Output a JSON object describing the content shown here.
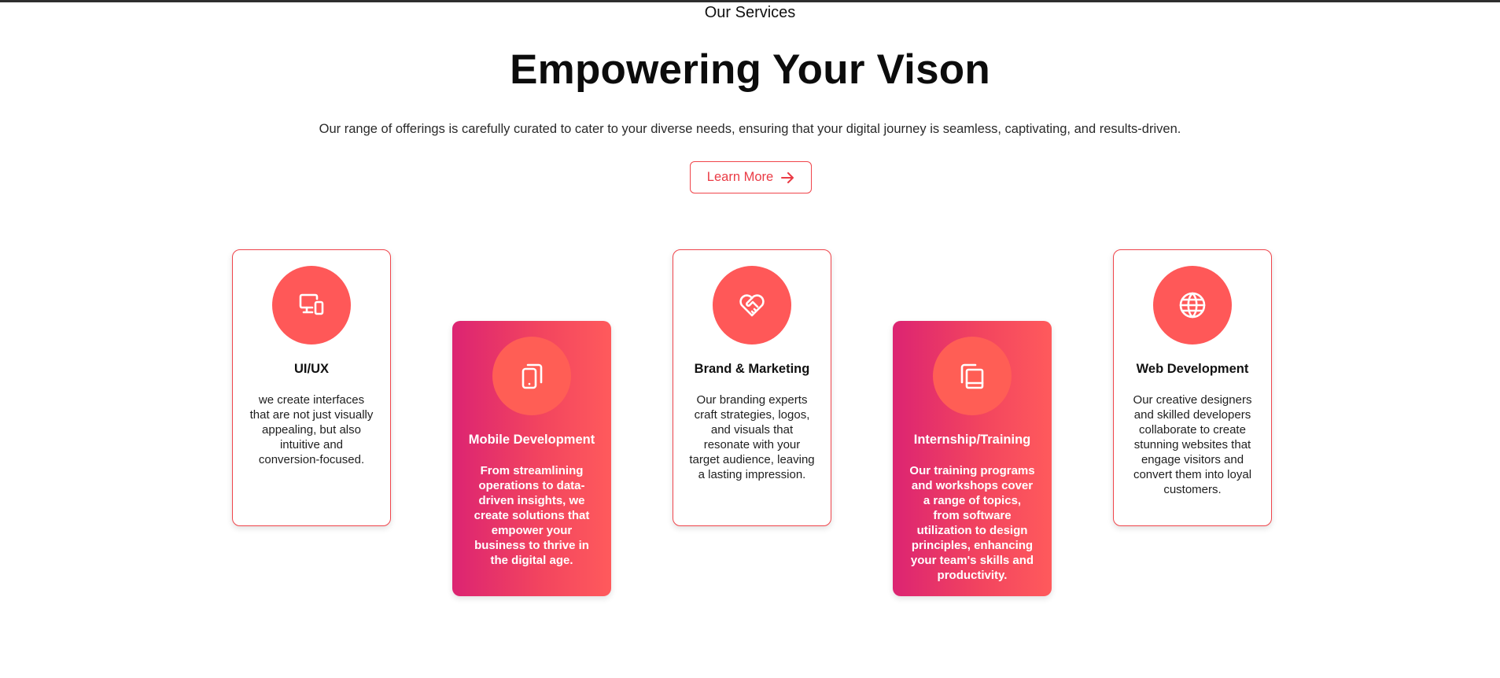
{
  "section": {
    "eyebrow": "Our Services",
    "headline": "Empowering Your Vison",
    "lead": "Our range of offerings is carefully curated to cater to your diverse needs, ensuring that your digital journey is seamless, captivating, and results-driven.",
    "cta_label": "Learn More"
  },
  "colors": {
    "accent": "#f0454b",
    "icon_bg": "#ff5858",
    "gradient_start": "#dc2472",
    "gradient_end": "#ff5a5c"
  },
  "cards": [
    {
      "icon": "devices-icon",
      "title": "UI/UX",
      "body": "we create interfaces that are not just visually appealing, but also intuitive and conversion-focused.",
      "style": "plain"
    },
    {
      "icon": "mobile-icon",
      "title": "Mobile Development",
      "body": "From streamlining operations to data-driven insights, we create solutions that empower your business to thrive in the digital age.",
      "style": "accent"
    },
    {
      "icon": "heart-handshake-icon",
      "title": "Brand & Marketing",
      "body": "Our branding experts craft strategies, logos, and visuals that resonate with your target audience, leaving a lasting impression.",
      "style": "plain"
    },
    {
      "icon": "book-icon",
      "title": "Internship/Training",
      "body": "Our training programs and workshops cover a range of topics, from software utilization to design principles, enhancing your team's skills and productivity.",
      "style": "accent"
    },
    {
      "icon": "globe-icon",
      "title": "Web Development",
      "body": "Our creative designers and skilled developers collaborate to create stunning websites that engage visitors and convert them into loyal customers.",
      "style": "plain"
    }
  ]
}
